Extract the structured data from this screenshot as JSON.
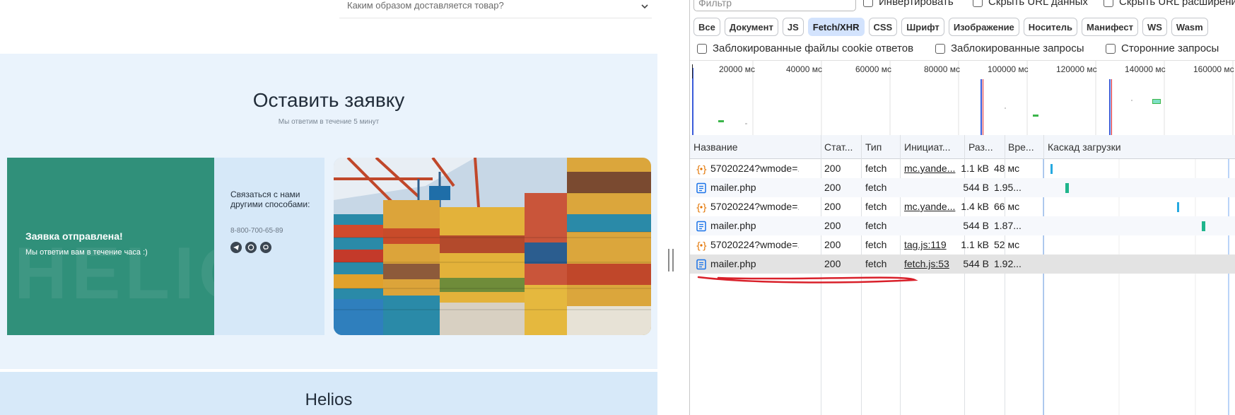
{
  "site": {
    "faq_question": "Каким образом доставляется товар?",
    "request": {
      "title": "Оставить заявку",
      "subtitle": "Мы ответим в течение 5 минут",
      "watermark": "HELIOS",
      "success_title": "Заявка отправлена!",
      "success_text": "Мы ответим вам в течение часа :)",
      "contact_title": "Связаться с нами другими способами:",
      "contact_phone": "8-800-700-65-89",
      "contact_icons": [
        "telegram-icon",
        "whatsapp-icon",
        "viber-icon"
      ]
    },
    "footer_brand": "Helios",
    "colors": {
      "success_panel": "#30907a",
      "section_bg": "#eaf3fc"
    }
  },
  "devtools": {
    "filter_placeholder": "Фильтр",
    "checkboxes_top": [
      {
        "label": "Инвертировать",
        "checked": false
      },
      {
        "label": "Скрыть URL данных",
        "checked": false
      },
      {
        "label": "Скрыть URL расширений",
        "checked": false
      }
    ],
    "type_filters": [
      {
        "label": "Все",
        "selected": false
      },
      {
        "label": "Документ",
        "selected": false
      },
      {
        "label": "JS",
        "selected": false
      },
      {
        "label": "Fetch/XHR",
        "selected": true
      },
      {
        "label": "CSS",
        "selected": false
      },
      {
        "label": "Шрифт",
        "selected": false
      },
      {
        "label": "Изображение",
        "selected": false
      },
      {
        "label": "Носитель",
        "selected": false
      },
      {
        "label": "Манифест",
        "selected": false
      },
      {
        "label": "WS",
        "selected": false
      },
      {
        "label": "Wasm",
        "selected": false
      }
    ],
    "checkboxes_bottom": [
      {
        "label": "Заблокированные файлы cookie ответов",
        "checked": false
      },
      {
        "label": "Заблокированные запросы",
        "checked": false
      },
      {
        "label": "Сторонние запросы",
        "checked": false
      }
    ],
    "timeline_ticks": [
      "20000 мс",
      "40000 мс",
      "60000 мс",
      "80000 мс",
      "100000 мс",
      "120000 мс",
      "140000 мс",
      "160000 мс"
    ],
    "columns": [
      "Название",
      "Стат...",
      "Тип",
      "Инициат...",
      "Раз...",
      "Вре...",
      "Каскад загрузки"
    ],
    "rows": [
      {
        "icon": "fetch",
        "name": "57020224?wmode=...",
        "status": "200",
        "type": "fetch",
        "initiator": "mc.yande...",
        "size": "1.1 kB",
        "time": "48 мс",
        "selected": false
      },
      {
        "icon": "doc",
        "name": "mailer.php",
        "status": "200",
        "type": "fetch",
        "initiator": "",
        "size": "544 B",
        "time": "1.95...",
        "selected": false
      },
      {
        "icon": "fetch",
        "name": "57020224?wmode=...",
        "status": "200",
        "type": "fetch",
        "initiator": "mc.yande...",
        "size": "1.4 kB",
        "time": "66 мс",
        "selected": false
      },
      {
        "icon": "doc",
        "name": "mailer.php",
        "status": "200",
        "type": "fetch",
        "initiator": "",
        "size": "544 B",
        "time": "1.87...",
        "selected": false
      },
      {
        "icon": "fetch",
        "name": "57020224?wmode=...",
        "status": "200",
        "type": "fetch",
        "initiator": "tag.js:119",
        "size": "1.1 kB",
        "time": "52 мс",
        "selected": false
      },
      {
        "icon": "doc",
        "name": "mailer.php",
        "status": "200",
        "type": "fetch",
        "initiator": "fetch.js:53",
        "size": "544 B",
        "time": "1.92...",
        "selected": true
      }
    ],
    "colors": {
      "selected_chip": "#d3e3fd",
      "annotation": "#d9202a"
    }
  }
}
